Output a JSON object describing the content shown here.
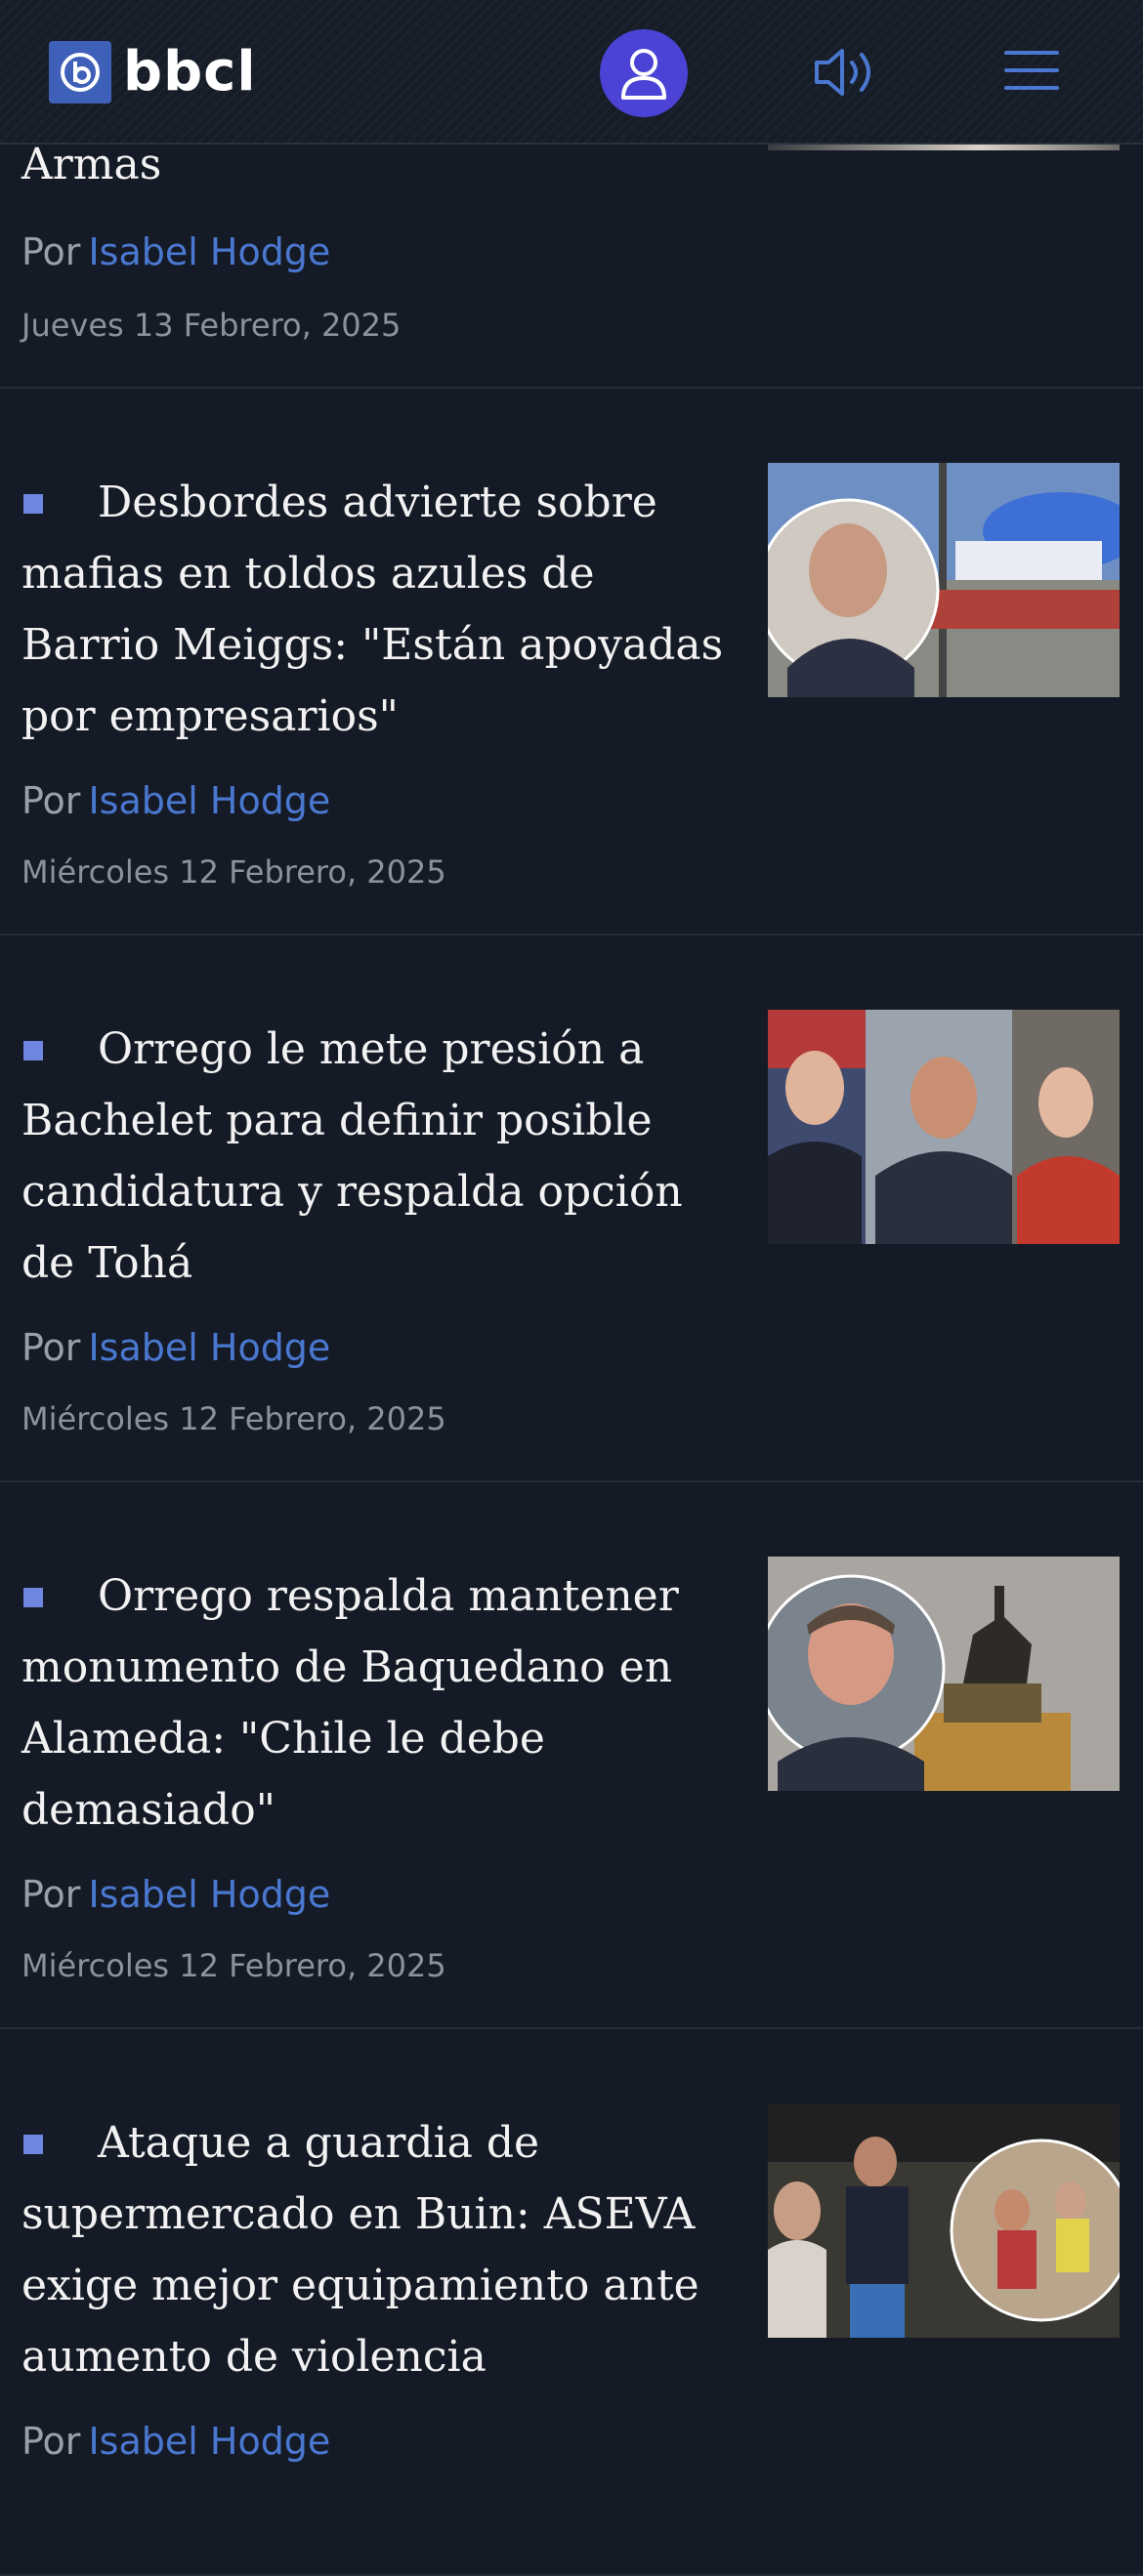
{
  "header": {
    "logo_text": "bbcl",
    "logo_icon": "bbcl-logo-icon",
    "user_icon": "user-icon",
    "audio_icon": "speaker-icon",
    "menu_icon": "hamburger-menu-icon",
    "colors": {
      "user_button": "#4a43d6",
      "accent": "#3f60b9"
    }
  },
  "articles": [
    {
      "headline": "Armas",
      "by": "Por",
      "author": "Isabel Hodge",
      "date": "Jueves 13 Febrero, 2025"
    },
    {
      "headline": "Desbordes advierte sobre mafias en toldos azules de Barrio Meiggs: \"Están apoyadas por empresarios\"",
      "by": "Por",
      "author": "Isabel Hodge",
      "date": "Miércoles 12 Febrero, 2025"
    },
    {
      "headline": "Orrego le mete presión a Bachelet para definir posible candidatura y respalda opción de Tohá",
      "by": "Por",
      "author": "Isabel Hodge",
      "date": "Miércoles 12 Febrero, 2025"
    },
    {
      "headline": "Orrego respalda mantener monumento de Baquedano en Alameda: \"Chile le debe demasiado\"",
      "by": "Por",
      "author": "Isabel Hodge",
      "date": "Miércoles 12 Febrero, 2025"
    },
    {
      "headline": "Ataque a guardia de supermercado en Buin: ASEVA exige mejor equipamiento ante aumento de violencia",
      "by": "Por",
      "author": "Isabel Hodge",
      "date": ""
    }
  ]
}
